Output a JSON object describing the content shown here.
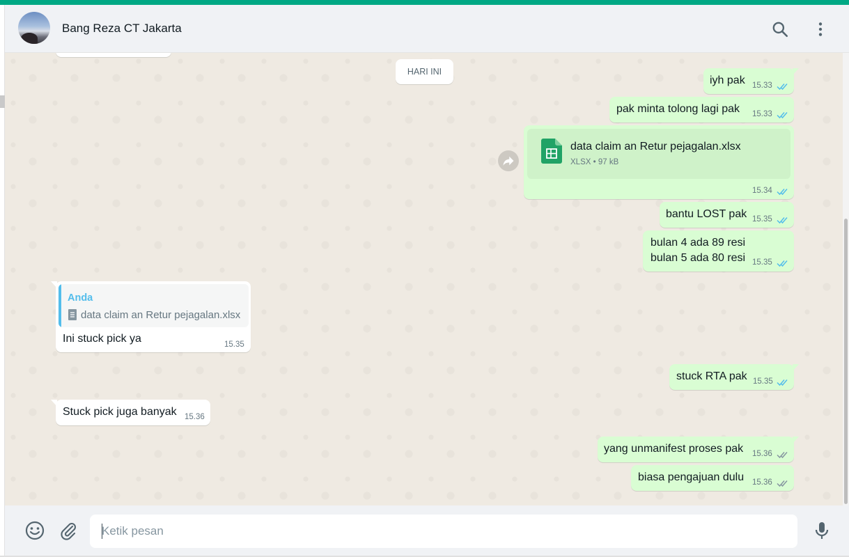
{
  "app": {
    "accent_color": "#00a884",
    "chat_bg_color": "#efeae2",
    "outgoing_bubble_color": "#d9fdd3",
    "incoming_bubble_color": "#ffffff",
    "read_tick_color": "#53bdeb"
  },
  "header": {
    "contact_name": "Bang Reza CT Jakarta",
    "avatar_icon": "contact-avatar",
    "search_icon": "search-icon",
    "menu_icon": "kebab-menu-icon"
  },
  "chat": {
    "day_separator": "HARI INI",
    "messages": [
      {
        "direction": "out",
        "text": "iyh pak",
        "time": "15.33",
        "status": "read"
      },
      {
        "direction": "out",
        "text": "pak minta tolong lagi pak",
        "time": "15.33",
        "status": "read"
      },
      {
        "direction": "out",
        "type": "document",
        "file_name": "data claim an Retur pejagalan.xlsx",
        "file_type": "XLSX",
        "separator": "•",
        "file_size": "97 kB",
        "time": "15.34",
        "status": "read",
        "file_icon": "spreadsheet-icon",
        "forward_icon": "forward-icon"
      },
      {
        "direction": "out",
        "text": "bantu LOST pak",
        "time": "15.35",
        "status": "read"
      },
      {
        "direction": "out",
        "lines": [
          "bulan 4 ada 89 resi",
          "bulan 5 ada 80 resi"
        ],
        "time": "15.35",
        "status": "read"
      },
      {
        "direction": "in",
        "quote": {
          "author": "Anda",
          "icon": "document-icon",
          "text": "data claim an Retur pejagalan.xlsx"
        },
        "text": "Ini stuck pick ya",
        "time": "15.35"
      },
      {
        "direction": "out",
        "text": "stuck RTA pak",
        "time": "15.35",
        "status": "read"
      },
      {
        "direction": "in",
        "text": "Stuck pick juga banyak",
        "time": "15.36"
      },
      {
        "direction": "out",
        "text": "yang unmanifest proses pak",
        "time": "15.36",
        "status": "delivered"
      },
      {
        "direction": "out",
        "text": "biasa pengajuan dulu",
        "time": "15.36",
        "status": "delivered"
      }
    ]
  },
  "composer": {
    "placeholder": "Ketik pesan",
    "value": "",
    "emoji_icon": "emoji-icon",
    "attach_icon": "paperclip-icon",
    "mic_icon": "microphone-icon"
  }
}
